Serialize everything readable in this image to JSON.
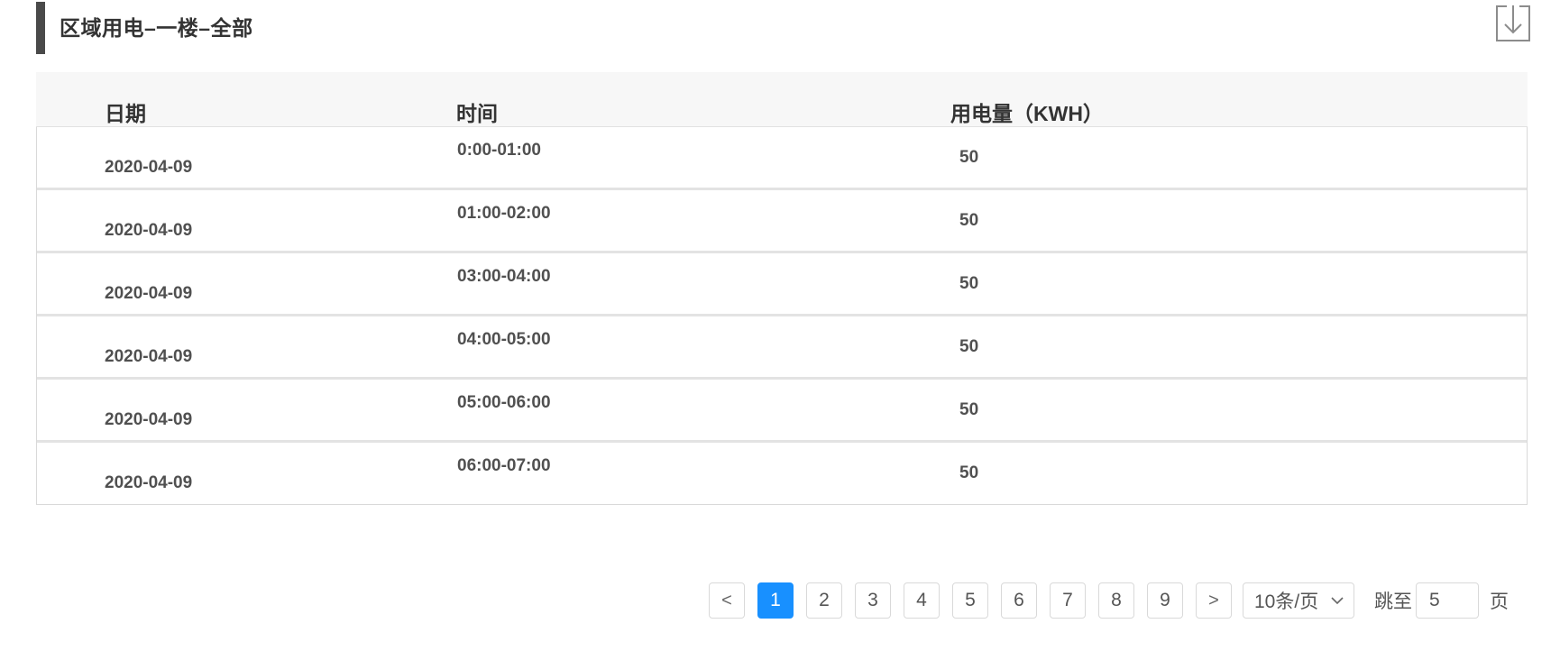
{
  "header": {
    "title": "区域用电–一楼–全部",
    "export_icon": "download-icon"
  },
  "table": {
    "columns": [
      "日期",
      "时间",
      "用电量（KWH）"
    ],
    "rows": [
      {
        "date": "2020-04-09",
        "time": "0:00-01:00",
        "usage": "50"
      },
      {
        "date": "2020-04-09",
        "time": "01:00-02:00",
        "usage": "50"
      },
      {
        "date": "2020-04-09",
        "time": "03:00-04:00",
        "usage": "50"
      },
      {
        "date": "2020-04-09",
        "time": "04:00-05:00",
        "usage": "50"
      },
      {
        "date": "2020-04-09",
        "time": "05:00-06:00",
        "usage": "50"
      },
      {
        "date": "2020-04-09",
        "time": "06:00-07:00",
        "usage": "50"
      }
    ]
  },
  "pagination": {
    "prev_label": "<",
    "next_label": ">",
    "pages": [
      "1",
      "2",
      "3",
      "4",
      "5",
      "6",
      "7",
      "8",
      "9"
    ],
    "current_page": "1",
    "page_size_label": "10条/页",
    "jump_label": "跳至",
    "jump_value": "5",
    "page_suffix": "页",
    "accent_color": "#1890ff"
  }
}
